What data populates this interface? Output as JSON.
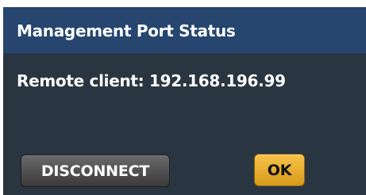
{
  "dialog": {
    "title": "Management Port Status",
    "message": "Remote client: 192.168.196.99",
    "buttons": {
      "disconnect": "DISCONNECT",
      "ok": "OK"
    }
  },
  "colors": {
    "title_bar": "#26456f",
    "body": "#2a3542",
    "ok_button": "#efb02e",
    "disconnect_button": "#4f4f4f"
  }
}
